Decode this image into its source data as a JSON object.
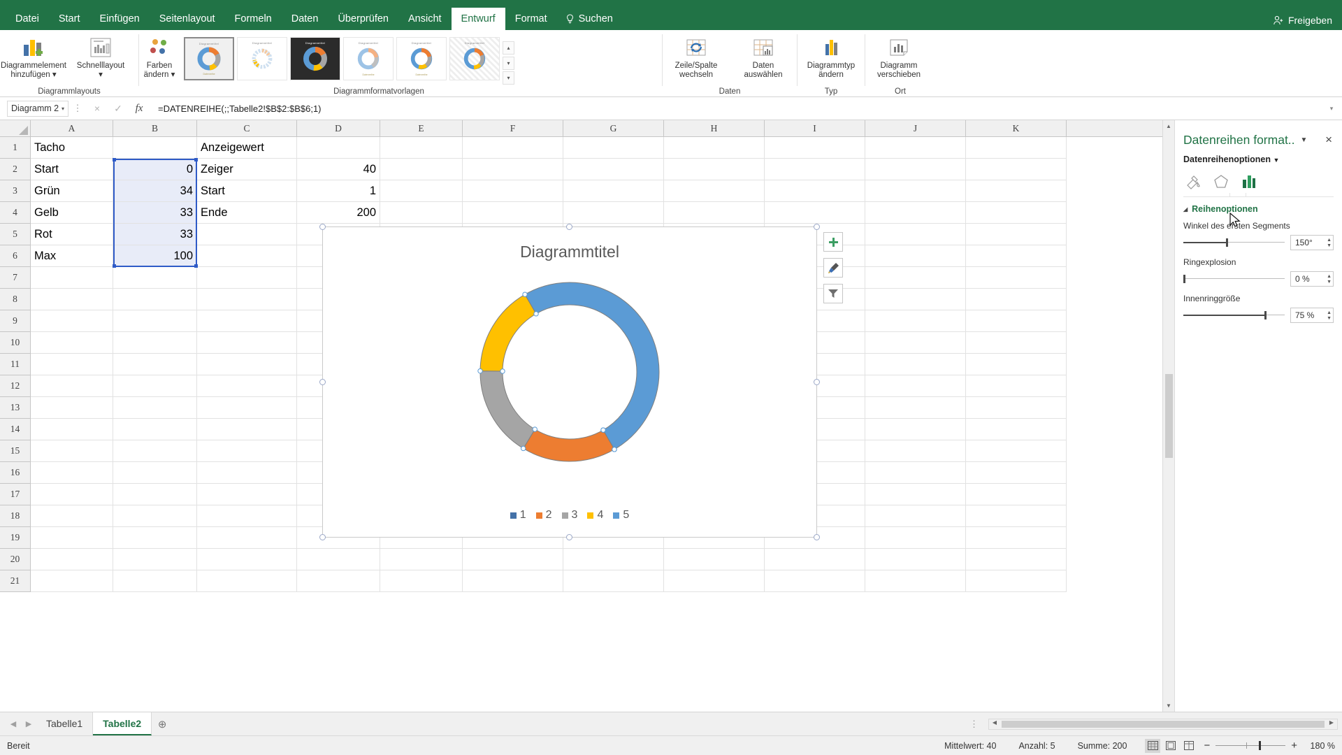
{
  "app": {
    "share_label": "Freigeben",
    "search_label": "Suchen"
  },
  "ribbon_tabs": [
    {
      "label": "Datei",
      "active": false
    },
    {
      "label": "Start",
      "active": false
    },
    {
      "label": "Einfügen",
      "active": false
    },
    {
      "label": "Seitenlayout",
      "active": false
    },
    {
      "label": "Formeln",
      "active": false
    },
    {
      "label": "Daten",
      "active": false
    },
    {
      "label": "Überprüfen",
      "active": false
    },
    {
      "label": "Ansicht",
      "active": false
    },
    {
      "label": "Entwurf",
      "active": true
    },
    {
      "label": "Format",
      "active": false
    }
  ],
  "ribbon": {
    "groups": [
      {
        "label": "Diagrammlayouts"
      },
      {
        "label": "Diagrammformatvorlagen"
      },
      {
        "label": "Daten"
      },
      {
        "label": "Typ"
      },
      {
        "label": "Ort"
      }
    ],
    "buttons": {
      "add_chart_element_l1": "Diagrammelement",
      "add_chart_element_l2": "hinzufügen",
      "quick_layout": "Schnelllayout",
      "change_colors_l1": "Farben",
      "change_colors_l2": "ändern",
      "switch_row_column_l1": "Zeile/Spalte",
      "switch_row_column_l2": "wechseln",
      "select_data_l1": "Daten",
      "select_data_l2": "auswählen",
      "change_chart_type_l1": "Diagrammtyp",
      "change_chart_type_l2": "ändern",
      "move_chart_l1": "Diagramm",
      "move_chart_l2": "verschieben"
    },
    "style_thumb_title": "Diagrammtitel",
    "style_thumb_sub": "Datenreihe"
  },
  "formula_bar": {
    "name_box": "Diagramm 2",
    "formula": "=DATENREIHE(;;Tabelle2!$B$2:$B$6;1)",
    "cancel_icon": "×",
    "confirm_icon": "✓",
    "fx_icon": "fx"
  },
  "grid": {
    "columns": [
      "A",
      "B",
      "C",
      "D",
      "E",
      "F",
      "G",
      "H",
      "I",
      "J",
      "K"
    ],
    "rows": [
      "1",
      "2",
      "3",
      "4",
      "5",
      "6",
      "7",
      "8",
      "9",
      "10",
      "11",
      "12",
      "13",
      "14",
      "15",
      "16",
      "17",
      "18",
      "19",
      "20",
      "21"
    ],
    "cells": [
      {
        "row": 1,
        "A": "Tacho",
        "B": "",
        "C": "Anzeigewert",
        "D": ""
      },
      {
        "row": 2,
        "A": "Start",
        "B": "0",
        "C": "Zeiger",
        "D": "40"
      },
      {
        "row": 3,
        "A": "Grün",
        "B": "34",
        "C": "Start",
        "D": "1"
      },
      {
        "row": 4,
        "A": "Gelb",
        "B": "33",
        "C": "Ende",
        "D": "200"
      },
      {
        "row": 5,
        "A": "Rot",
        "B": "33",
        "C": "",
        "D": ""
      },
      {
        "row": 6,
        "A": "Max",
        "B": "100",
        "C": "",
        "D": ""
      }
    ],
    "selected_range": "B2:B6"
  },
  "chart": {
    "title": "Diagrammtitel",
    "buttons": {
      "add": "+",
      "style": "brush",
      "filter": "filter"
    }
  },
  "chart_data": {
    "type": "pie",
    "variant": "doughnut",
    "title": "Diagrammtitel",
    "categories": [
      "1",
      "2",
      "3",
      "4",
      "5"
    ],
    "values": [
      0,
      34,
      33,
      33,
      100
    ],
    "source_range": "Tabelle2!$B$2:$B$6",
    "labels": [
      "Start",
      "Grün",
      "Gelb",
      "Rot",
      "Max"
    ],
    "colors": [
      "#4472a8",
      "#ed7d31",
      "#a5a5a5",
      "#ffc000",
      "#5b9bd5"
    ],
    "legend_position": "bottom",
    "legend_entries": [
      "1",
      "2",
      "3",
      "4",
      "5"
    ],
    "first_slice_angle_deg": 150,
    "doughnut_hole_pct": 75,
    "explosion_pct": 0,
    "total": 200
  },
  "task_pane": {
    "title": "Datenreihen format..",
    "subtitle": "Datenreihenoptionen",
    "close_icon": "×",
    "icon_tabs": [
      {
        "name": "fill-line-icon",
        "selected": false
      },
      {
        "name": "effects-icon",
        "selected": false
      },
      {
        "name": "series-options-icon",
        "selected": true
      }
    ],
    "section_title": "Reihenoptionen",
    "fields": [
      {
        "label": "Winkel des ersten Segments",
        "value": "150°",
        "pct": 42
      },
      {
        "label": "Ringexplosion",
        "value": "0 %",
        "pct": 0
      },
      {
        "label": "Innenringgröße",
        "value": "75 %",
        "pct": 80
      }
    ]
  },
  "sheet_tabs": {
    "items": [
      {
        "label": "Tabelle1",
        "active": false
      },
      {
        "label": "Tabelle2",
        "active": true
      }
    ],
    "add_icon": "+"
  },
  "status_bar": {
    "state": "Bereit",
    "average": "Mittelwert: 40",
    "count": "Anzahl: 5",
    "sum": "Summe: 200",
    "zoom": "180 %"
  }
}
